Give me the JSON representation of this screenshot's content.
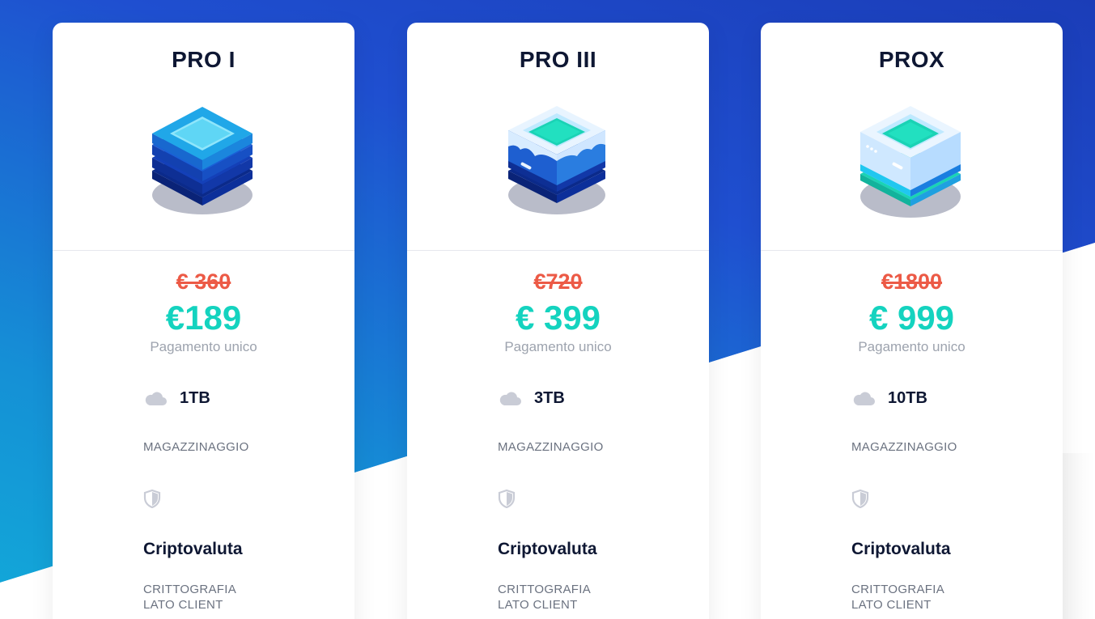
{
  "plans": [
    {
      "name": "PRO I",
      "old_price": "€ 360",
      "price": "€189",
      "payment_note": "Pagamento unico",
      "storage": "1TB",
      "storage_label": "MAGAZZINAGGIO",
      "feature_title": "Criptovaluta",
      "feature_sub_line1": "CRITTOGRAFIA",
      "feature_sub_line2": "LATO CLIENT",
      "illustration": "layered-stack-icon"
    },
    {
      "name": "PRO III",
      "old_price": "€720",
      "price": "€ 399",
      "payment_note": "Pagamento unico",
      "storage": "3TB",
      "storage_label": "MAGAZZINAGGIO",
      "feature_title": "Criptovaluta",
      "feature_sub_line1": "CRITTOGRAFIA",
      "feature_sub_line2": "LATO CLIENT",
      "illustration": "ice-box-stack-icon"
    },
    {
      "name": "PROX",
      "old_price": "€1800",
      "price": "€ 999",
      "payment_note": "Pagamento unico",
      "storage": "10TB",
      "storage_label": "MAGAZZINAGGIO",
      "feature_title": "Criptovaluta",
      "feature_sub_line1": "CRITTOGRAFIA",
      "feature_sub_line2": "LATO CLIENT",
      "illustration": "server-box-icon"
    }
  ],
  "colors": {
    "old_price": "#ec5a46",
    "new_price": "#14d3bf",
    "title": "#0e1733",
    "background_blue": "#1f4fd0"
  },
  "icons": {
    "storage": "cloud-icon",
    "security": "shield-icon"
  }
}
